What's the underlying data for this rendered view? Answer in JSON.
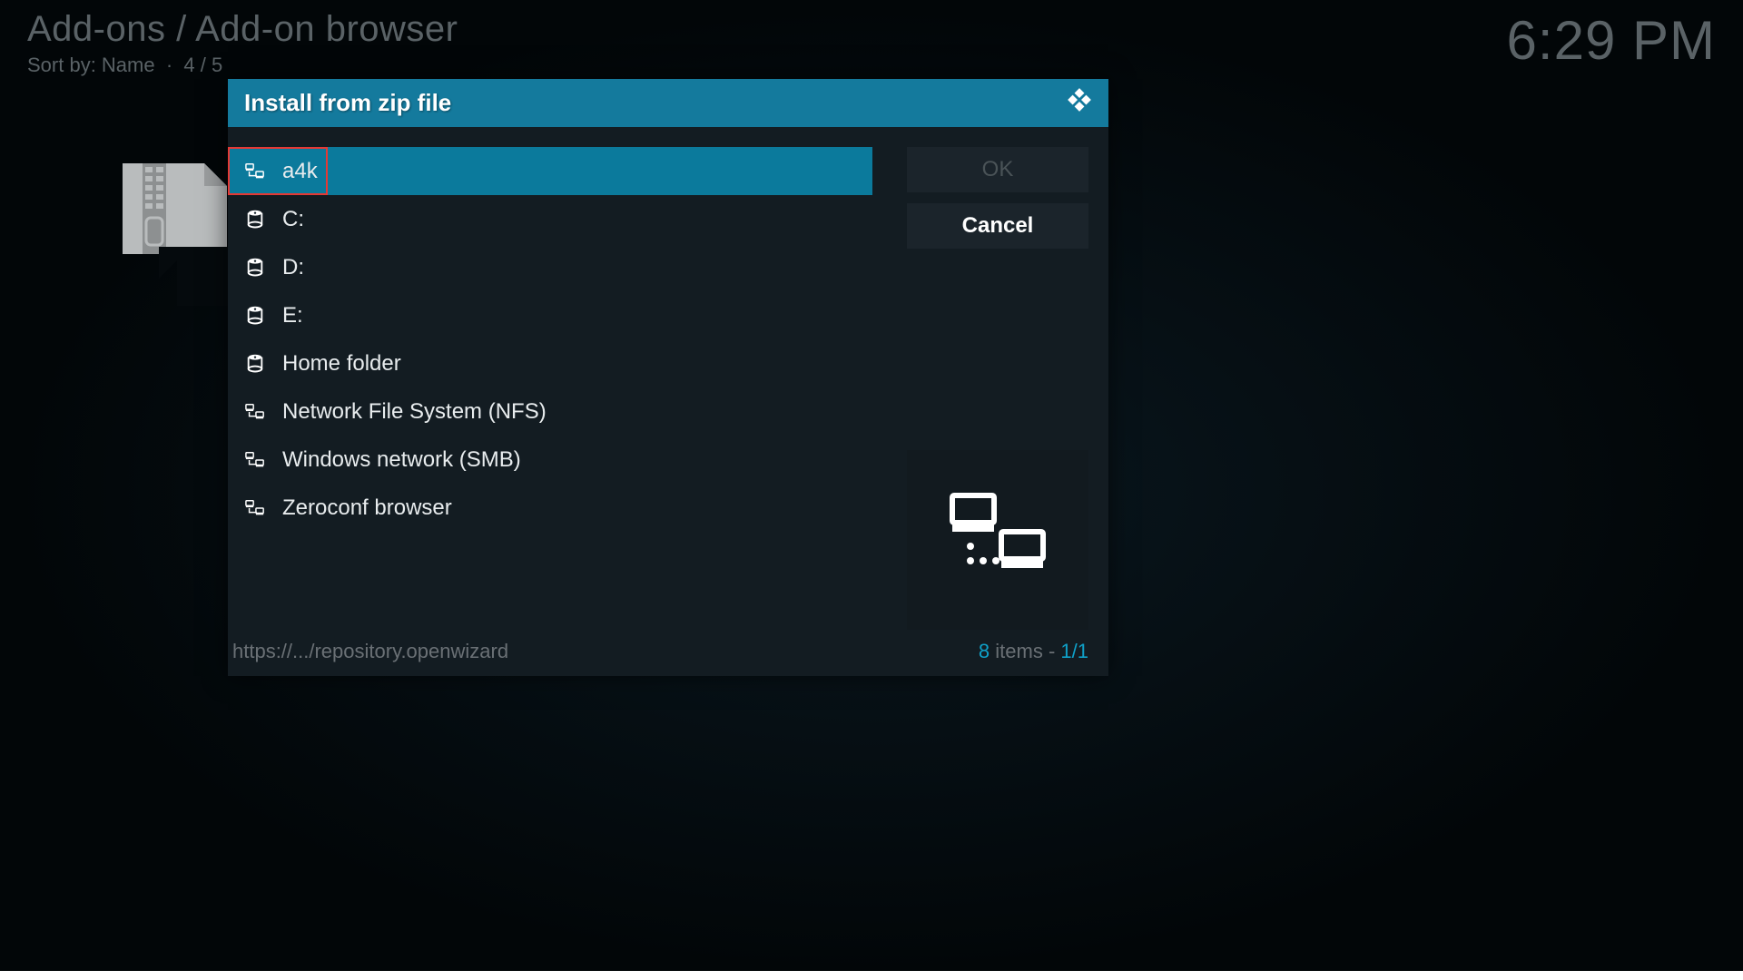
{
  "header": {
    "breadcrumb": "Add-ons / Add-on browser",
    "sort_label": "Sort by: Name",
    "sort_sep": "·",
    "position": "4 / 5",
    "clock": "6:29 PM"
  },
  "dialog": {
    "title": "Install from zip file",
    "items": [
      {
        "label": "a4k",
        "icon": "network",
        "selected": true,
        "highlighted": true
      },
      {
        "label": "C:",
        "icon": "drive",
        "selected": false
      },
      {
        "label": "D:",
        "icon": "drive",
        "selected": false
      },
      {
        "label": "E:",
        "icon": "drive",
        "selected": false
      },
      {
        "label": "Home folder",
        "icon": "drive",
        "selected": false
      },
      {
        "label": "Network File System (NFS)",
        "icon": "network",
        "selected": false
      },
      {
        "label": "Windows network (SMB)",
        "icon": "network",
        "selected": false
      },
      {
        "label": "Zeroconf browser",
        "icon": "network",
        "selected": false
      }
    ],
    "buttons": {
      "ok": "OK",
      "cancel": "Cancel"
    },
    "footer": {
      "path": "https://.../repository.openwizard",
      "count_num": "8",
      "count_text": " items - ",
      "page": "1/1"
    }
  }
}
